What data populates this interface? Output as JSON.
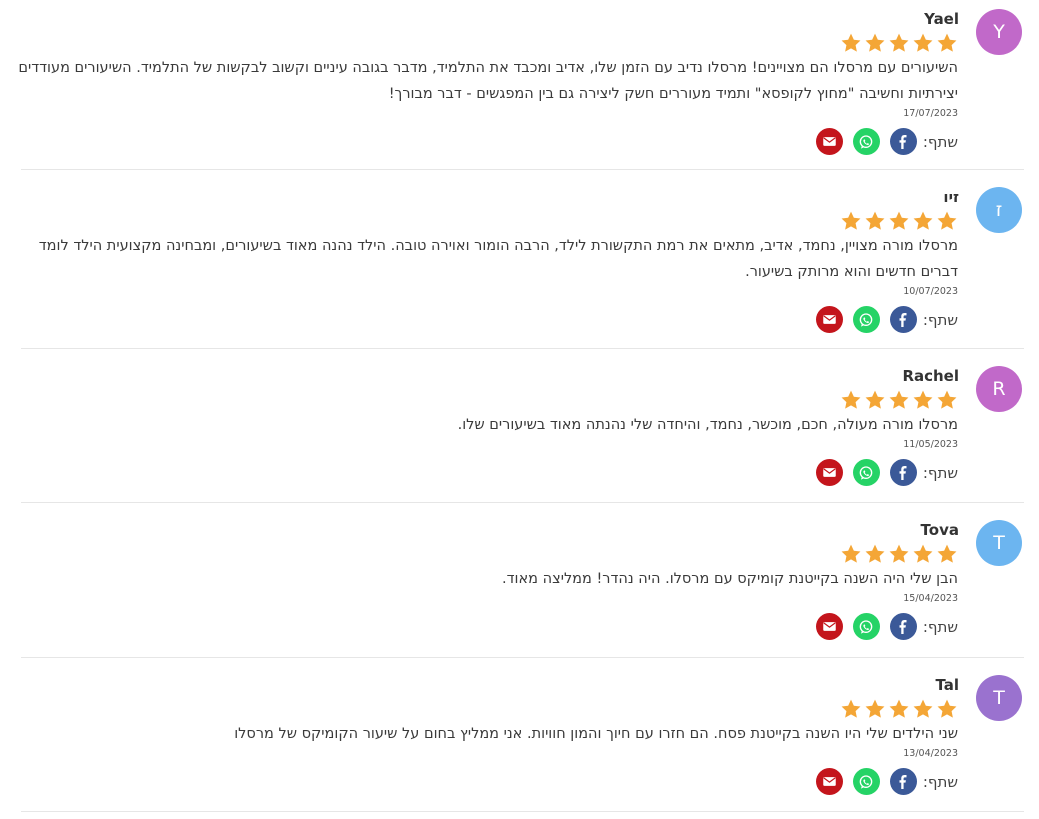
{
  "share_label": "שתף:",
  "rating_max": 5,
  "colors": {
    "star": "#f4a636",
    "facebook": "#3b5998",
    "whatsapp": "#25d366",
    "email": "#c4151c"
  },
  "reviews": [
    {
      "initial": "Y",
      "name": "Yael",
      "avatar_color": "#c169c9",
      "rating": 5,
      "text": "השיעורים עם מרסלו הם מצויינים! מרסלו נדיב עם הזמן שלו, אדיב ומכבד את התלמיד, מדבר בגובה עיניים וקשוב לבקשות של התלמיד. השיעורים מעודדים יצירתיות וחשיבה \"מחוץ לקופסא\" ותמיד מעוררים חשק ליצירה גם בין המפגשים - דבר מבורך!",
      "date": "17/07/2023"
    },
    {
      "initial": "ז",
      "name": "זיו",
      "avatar_color": "#6cb5f0",
      "rating": 5,
      "text": "מרסלו מורה מצויין, נחמד, אדיב, מתאים את רמת התקשורת לילד, הרבה הומור ואוירה טובה. הילד נהנה מאוד בשיעורים, ומבחינה מקצועית הילד לומד דברים חדשים והוא מרותק בשיעור.",
      "date": "10/07/2023"
    },
    {
      "initial": "R",
      "name": "Rachel",
      "avatar_color": "#c169c9",
      "rating": 5,
      "text": "מרסלו מורה מעולה, חכם, מוכשר, נחמד, והיחדה שלי נהנתה מאוד בשיעורים שלו.",
      "date": "11/05/2023"
    },
    {
      "initial": "T",
      "name": "Tova",
      "avatar_color": "#6cb5f0",
      "rating": 5,
      "text": "הבן שלי היה השנה בקייטנת קומיקס עם מרסלו. היה נהדר! ממליצה מאוד.",
      "date": "15/04/2023"
    },
    {
      "initial": "T",
      "name": "Tal",
      "avatar_color": "#9a72cf",
      "rating": 5,
      "text": "שני הילדים שלי היו השנה בקייטנת פסח. הם חזרו עם חיוך והמון חוויות. אני ממליץ בחום על שיעור הקומיקס של מרסלו",
      "date": "13/04/2023"
    }
  ]
}
